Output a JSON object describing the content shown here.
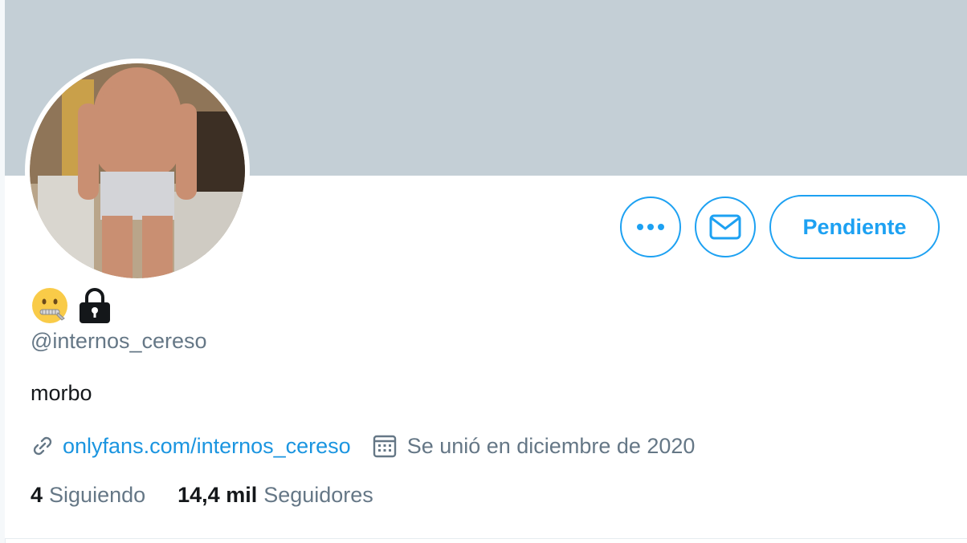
{
  "profile": {
    "handle": "@internos_cereso",
    "bio": "morbo",
    "name_icons": [
      "zipper-mouth-face-icon",
      "lock-icon"
    ],
    "website": "onlyfans.com/internos_cereso",
    "joined": "Se unió en diciembre de 2020",
    "following_count": "4",
    "following_label": "Siguiendo",
    "followers_count": "14,4 mil",
    "followers_label": "Seguidores"
  },
  "actions": {
    "more_icon": "more-icon",
    "message_icon": "envelope-icon",
    "follow_status_label": "Pendiente"
  },
  "colors": {
    "banner": "#c4cfd6",
    "accent": "#1da1f2",
    "secondary_text": "#657786"
  }
}
